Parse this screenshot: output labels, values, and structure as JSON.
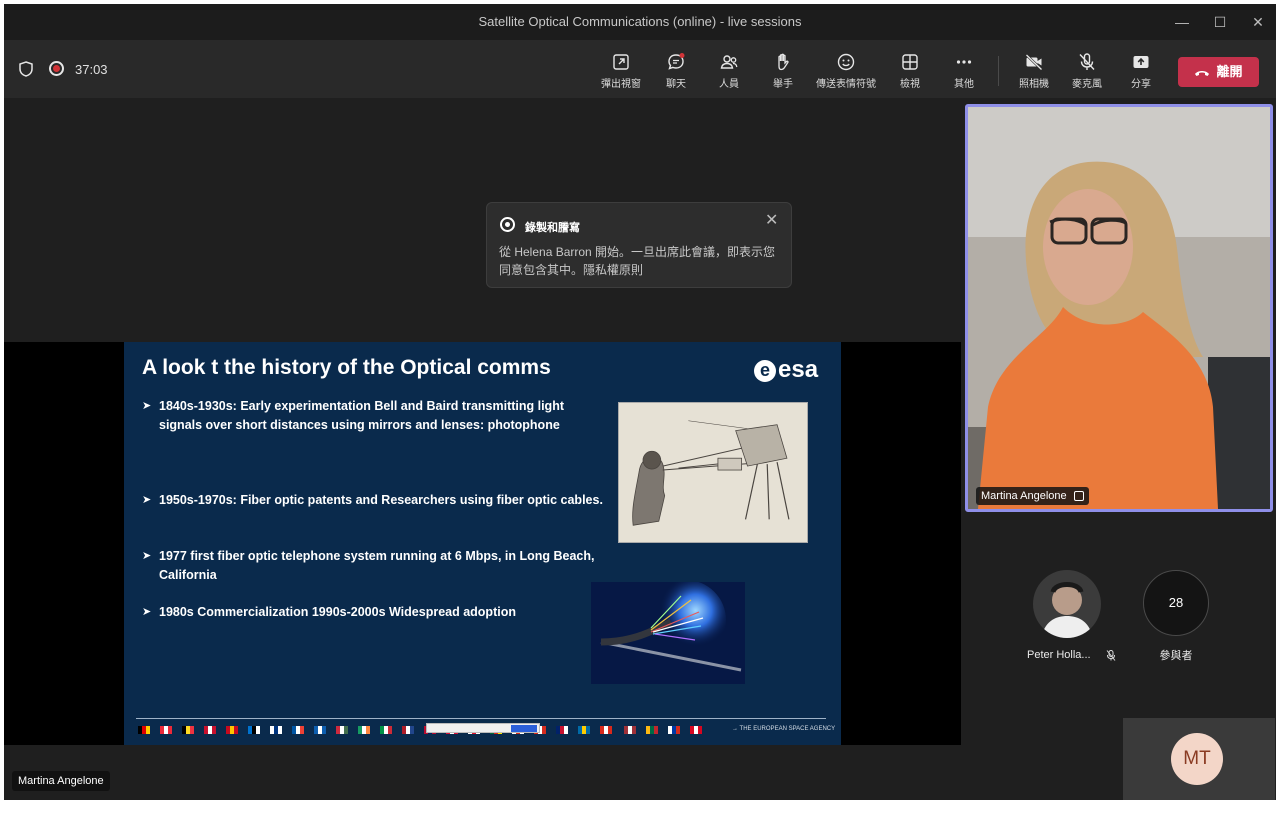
{
  "window": {
    "title": "Satellite Optical Communications (online) - live sessions"
  },
  "toolbar": {
    "timer": "37:03",
    "buttons": {
      "popout": "彈出視窗",
      "chat": "聊天",
      "people": "人員",
      "raise_hand": "舉手",
      "reactions": "傳送表情符號",
      "view": "檢視",
      "more": "其他",
      "camera": "照相機",
      "mic": "麥克風",
      "share": "分享"
    },
    "leave": "離開"
  },
  "toast": {
    "title": "錄製和謄寫",
    "body": "從 Helena Barron 開始。一旦出席此會議，即表示您同意包含其中。隱私權原則"
  },
  "slide": {
    "title": "A look t the history of the Optical comms",
    "logo": "esa",
    "bullets": [
      "1840s-1930s: Early experimentation Bell and Baird transmitting light signals over short distances using mirrors and lenses: photophone",
      "1950s-1970s: Fiber optic patents and Researchers using fiber optic cables.",
      "1977 first fiber optic telephone system  running at 6 Mbps, in Long Beach, California",
      "1980s Commercialization 1990s-2000s Widespread adoption"
    ],
    "footer": "→ THE EUROPEAN SPACE AGENCY"
  },
  "speaker_label": "Martina Angelone",
  "camera_tile": {
    "name": "Martina Angelone"
  },
  "participants": {
    "person": "Peter Holla...",
    "count": "28",
    "count_label": "參與者",
    "self_initials": "MT"
  },
  "colors": {
    "leave": "#c4314b",
    "active_border": "#8f8fe8",
    "slide_bg": "#0a2a4c"
  }
}
